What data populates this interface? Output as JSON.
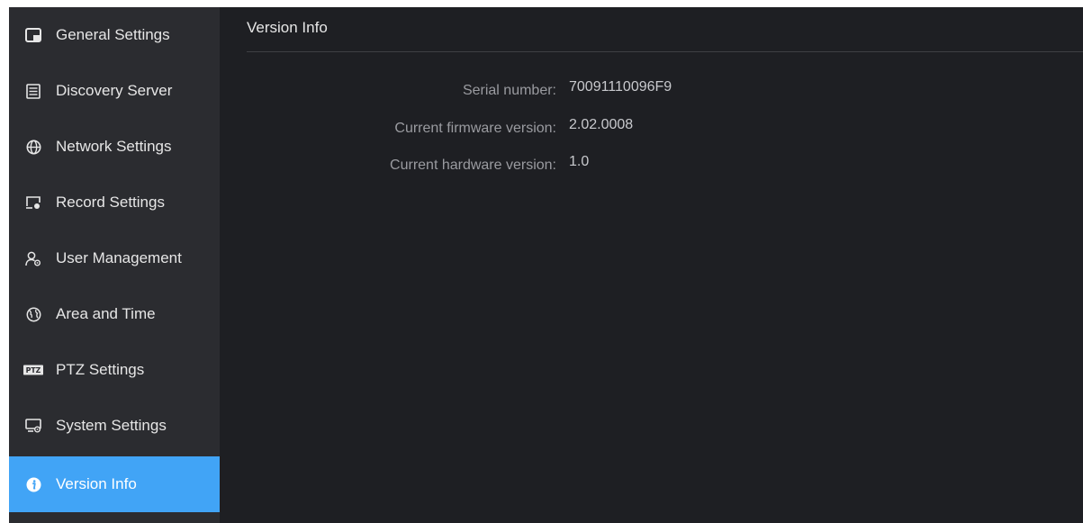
{
  "sidebar": {
    "items": [
      {
        "label": "General Settings",
        "icon": "general-settings-icon"
      },
      {
        "label": "Discovery Server",
        "icon": "discovery-server-icon"
      },
      {
        "label": "Network Settings",
        "icon": "globe-icon"
      },
      {
        "label": "Record Settings",
        "icon": "record-settings-icon"
      },
      {
        "label": "User Management",
        "icon": "user-management-icon"
      },
      {
        "label": "Area and Time",
        "icon": "area-time-icon"
      },
      {
        "label": "PTZ Settings",
        "icon": "ptz-icon"
      },
      {
        "label": "System Settings",
        "icon": "system-settings-icon"
      },
      {
        "label": "Version Info",
        "icon": "info-icon"
      }
    ],
    "active": "Version Info"
  },
  "main": {
    "title": "Version Info",
    "fields": [
      {
        "label": "Serial number:",
        "value": "70091110096F9"
      },
      {
        "label": "Current firmware version:",
        "value": "2.02.0008"
      },
      {
        "label": "Current hardware version:",
        "value": "1.0"
      }
    ]
  },
  "colors": {
    "background": "#1e1f23",
    "sidebar": "#2b2c30",
    "accent": "#41a4f6"
  }
}
